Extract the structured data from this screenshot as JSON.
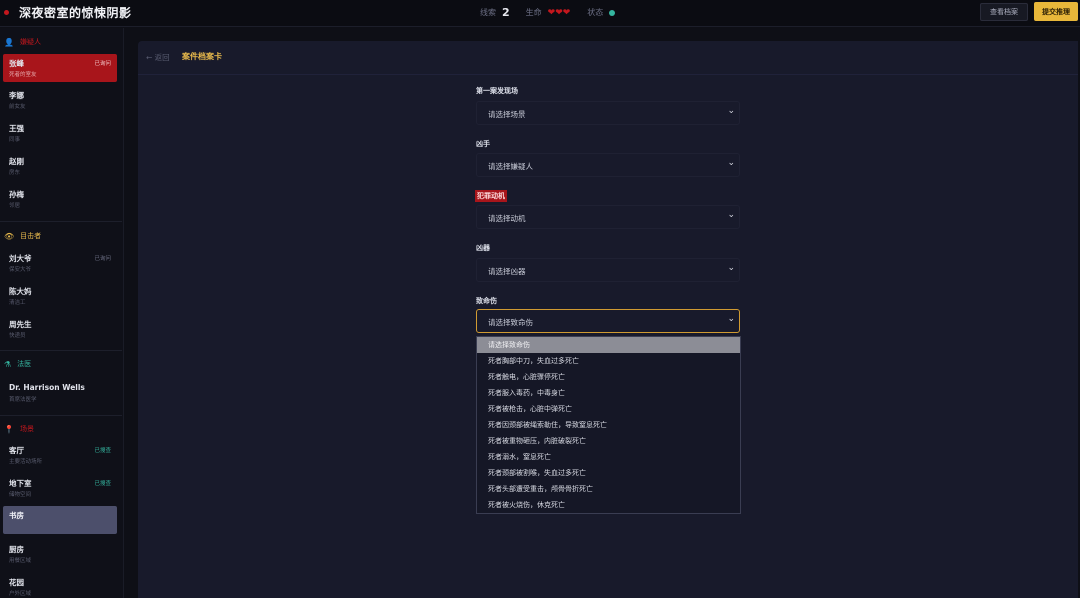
{
  "header": {
    "title": "深夜密室的惊悚阴影",
    "stats": {
      "clues_label": "线索",
      "clues_value": "2",
      "lives_label": "生命",
      "hearts": "❤❤❤",
      "status_label": "状态"
    },
    "view_button": "查看档案",
    "submit_button": "提交推理"
  },
  "sidebar": {
    "sections": [
      {
        "title": "嫌疑人",
        "color": "#c4171d",
        "icon": "person-icon"
      },
      {
        "title": "目击者",
        "color": "#e7b94c",
        "icon": "eye-icon"
      },
      {
        "title": "法医",
        "color": "#35b6a0",
        "icon": "lab-icon"
      },
      {
        "title": "场景",
        "color": "#c4171d",
        "icon": "pin-icon"
      }
    ],
    "suspects": [
      {
        "name": "张峰",
        "sub": "死者的室友",
        "badge": "已询问"
      },
      {
        "name": "李娜",
        "sub": "前女友",
        "badge": ""
      },
      {
        "name": "王强",
        "sub": "同事",
        "badge": ""
      },
      {
        "name": "赵刚",
        "sub": "房东",
        "badge": ""
      },
      {
        "name": "孙梅",
        "sub": "邻居",
        "badge": ""
      }
    ],
    "witnesses": [
      {
        "name": "刘大爷",
        "sub": "保安大爷",
        "badge": "已询问"
      },
      {
        "name": "陈大妈",
        "sub": "清洁工",
        "badge": ""
      },
      {
        "name": "周先生",
        "sub": "快递员",
        "badge": ""
      }
    ],
    "forensics": [
      {
        "name": "Dr. Harrison Wells",
        "sub": "首席法医学"
      }
    ],
    "scenes": [
      {
        "name": "客厅",
        "sub": "主要活动场所",
        "badge": "已搜查"
      },
      {
        "name": "地下室",
        "sub": "储物空间",
        "badge": "已搜查"
      },
      {
        "name": "书房",
        "sub": "",
        "badge": ""
      },
      {
        "name": "厨房",
        "sub": "用餐区域",
        "badge": ""
      },
      {
        "name": "花园",
        "sub": "户外区域",
        "badge": ""
      }
    ]
  },
  "main": {
    "back": "← 返回",
    "title": "案件档案卡",
    "fields": [
      {
        "label": "第一案发现场",
        "value": "请选择场景"
      },
      {
        "label": "凶手",
        "value": "请选择嫌疑人"
      },
      {
        "label": "犯罪动机",
        "value": "请选择动机"
      },
      {
        "label": "凶器",
        "value": "请选择凶器"
      },
      {
        "label": "致命伤",
        "value": "请选择致命伤"
      }
    ],
    "dropdown_options": [
      "请选择致命伤",
      "死者胸部中刀，失血过多死亡",
      "死者触电，心脏骤停死亡",
      "死者服入毒药，中毒身亡",
      "死者被枪击，心脏中弹死亡",
      "死者因颈部被绳索勒住，导致窒息死亡",
      "死者被重物砸压，内脏破裂死亡",
      "死者溺水，窒息死亡",
      "死者颈部被割喉，失血过多死亡",
      "死者头部遭受重击，颅骨骨折死亡",
      "死者被火烧伤，休克死亡"
    ]
  },
  "colors": {
    "accent_red": "#a8151b",
    "accent_gold": "#e8b73a",
    "teal": "#35b6a0",
    "panel": "#181a2b"
  }
}
